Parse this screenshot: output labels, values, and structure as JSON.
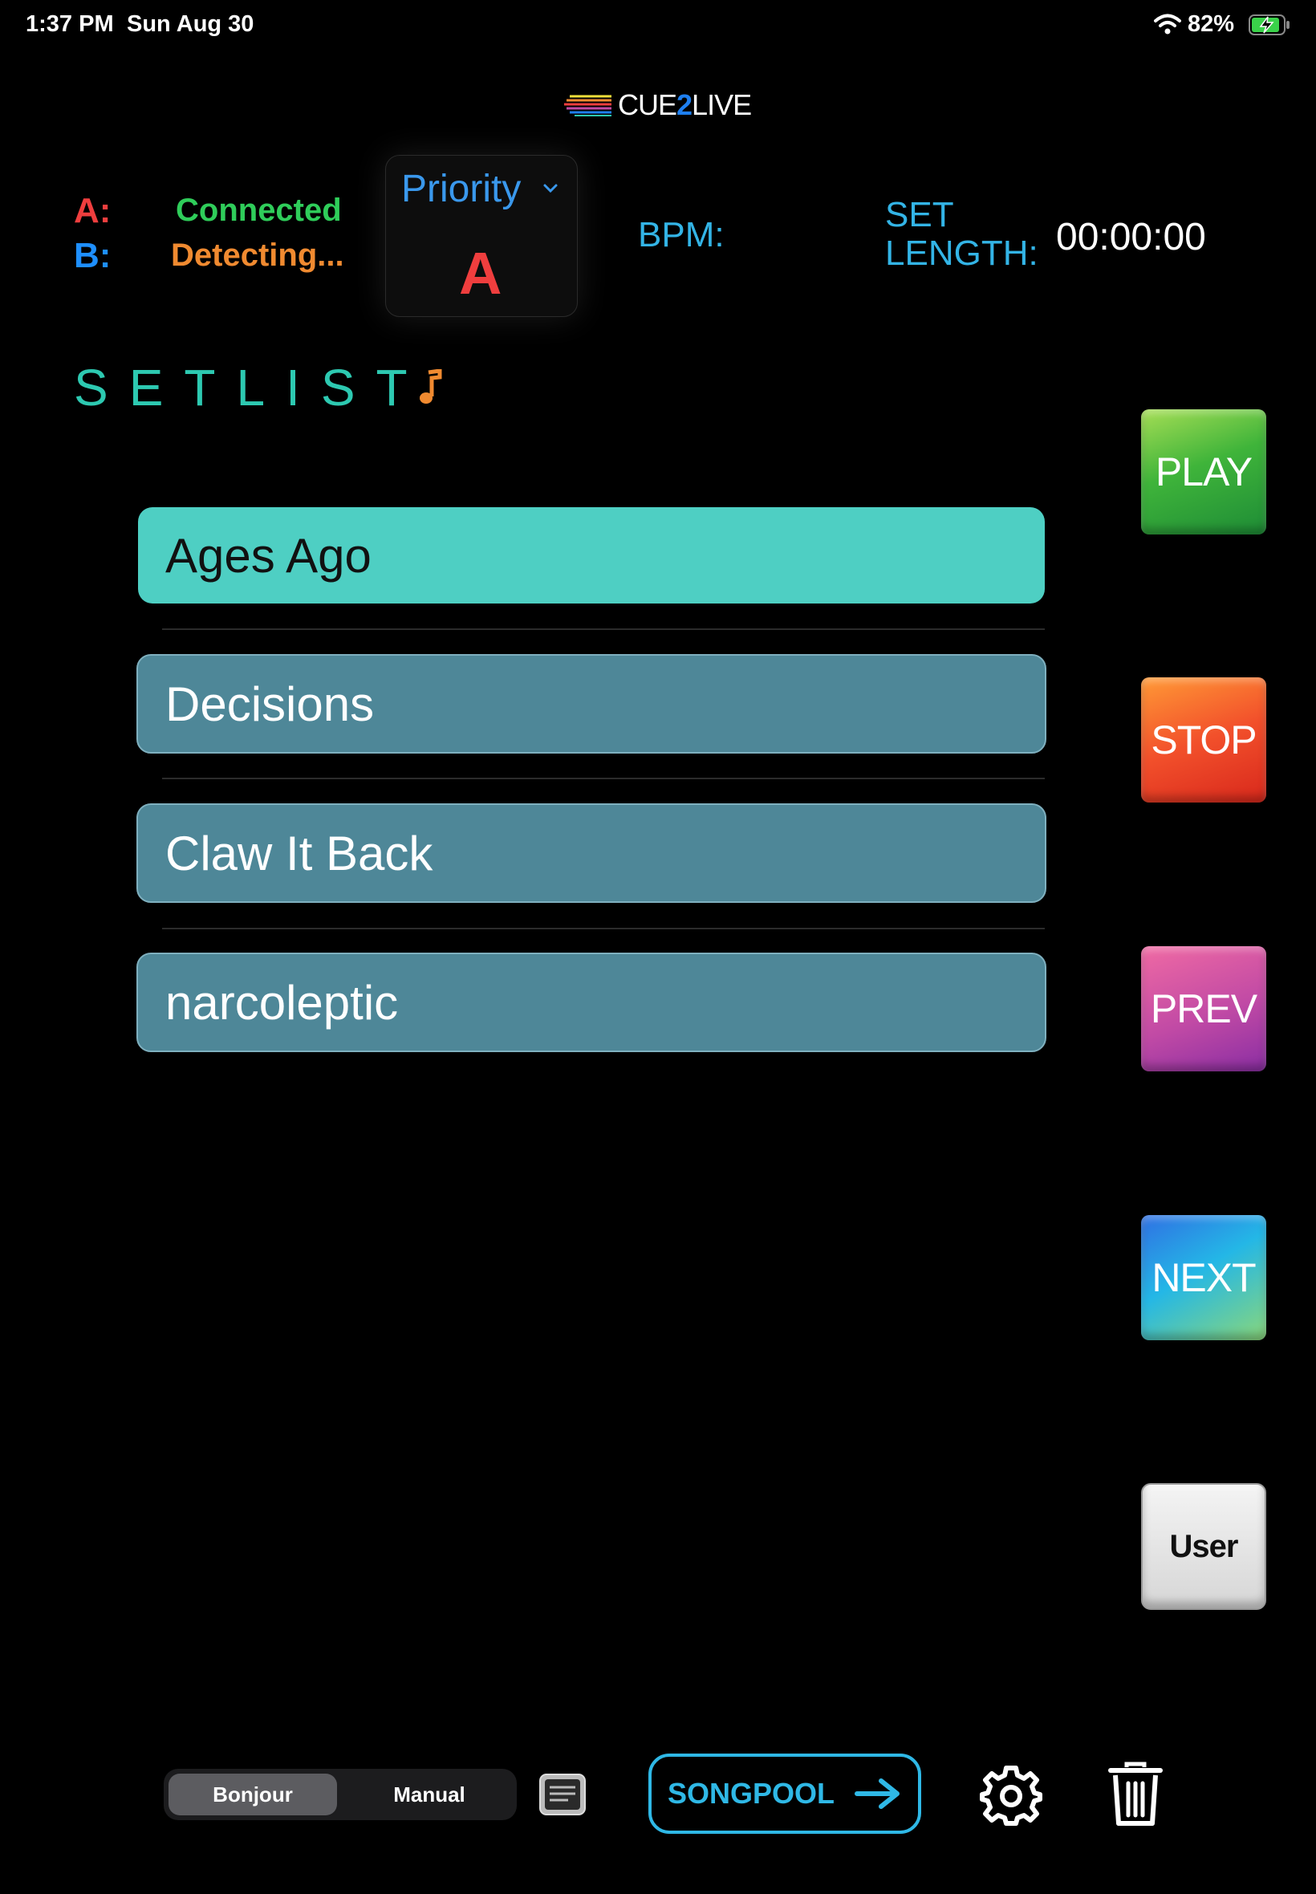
{
  "status_bar": {
    "time": "1:37 PM",
    "date": "Sun Aug 30",
    "battery": "82%"
  },
  "logo": {
    "pre": "CUE",
    "mid": "2",
    "post": "LIVE"
  },
  "connection": {
    "a_label": "A:",
    "a_status": "Connected",
    "b_label": "B:",
    "b_status": "Detecting..."
  },
  "priority": {
    "label": "Priority",
    "value": "A"
  },
  "bpm": {
    "label": "BPM:"
  },
  "set_length": {
    "label_line1": "SET",
    "label_line2": "LENGTH:",
    "value": "00:00:00"
  },
  "setlist": {
    "heading": "SETLIST",
    "songs": [
      {
        "title": "Ages Ago",
        "active": true
      },
      {
        "title": "Decisions",
        "active": false
      },
      {
        "title": "Claw It Back",
        "active": false
      },
      {
        "title": "narcoleptic",
        "active": false
      }
    ]
  },
  "transport": {
    "play": "PLAY",
    "stop": "STOP",
    "prev": "PREV",
    "next": "NEXT",
    "user": "User"
  },
  "bottom_bar": {
    "mode_options": [
      "Bonjour",
      "Manual"
    ],
    "selected_mode": "Bonjour",
    "songpool_label": "SONGPOOL"
  },
  "colors": {
    "accent_teal": "#2dc9b1",
    "active_row": "#4ecfc3",
    "inactive_row": "#4e8798",
    "connected": "#2fcd5a",
    "detecting": "#f08a30",
    "a_red": "#ef3e3e",
    "b_blue": "#1e8fff"
  },
  "icons": [
    "wifi-icon",
    "battery-charging-icon",
    "chevron-down-icon",
    "music-note-icon",
    "document-icon",
    "arrow-right-icon",
    "gear-icon",
    "trash-icon"
  ]
}
